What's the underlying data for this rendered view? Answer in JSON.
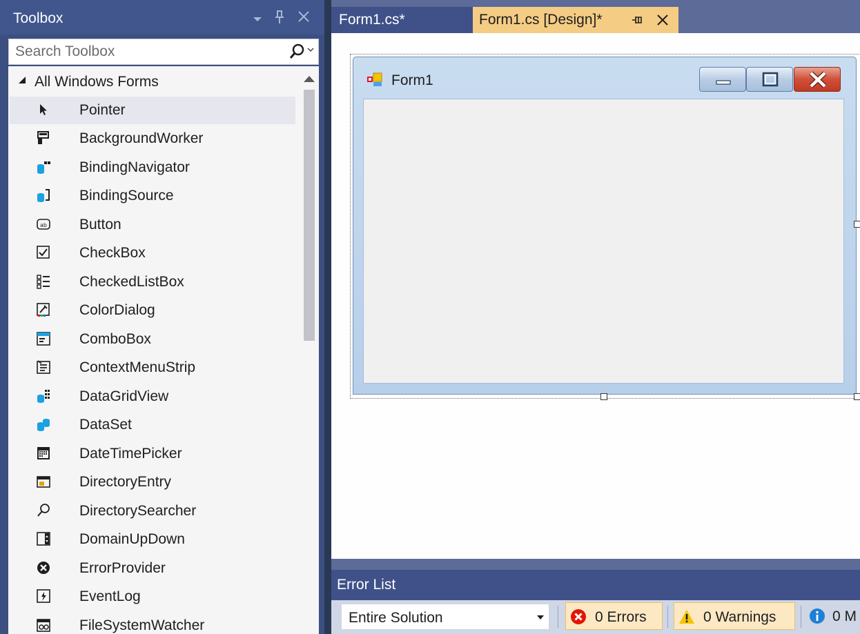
{
  "toolbox": {
    "title": "Toolbox",
    "header_icons": [
      "dropdown-arrow-icon",
      "pin-icon",
      "close-icon"
    ],
    "search_placeholder": "Search Toolbox",
    "group_label": "All Windows Forms",
    "items": [
      {
        "label": "Pointer",
        "icon": "pointer-icon"
      },
      {
        "label": "BackgroundWorker",
        "icon": "background-worker-icon"
      },
      {
        "label": "BindingNavigator",
        "icon": "binding-navigator-icon"
      },
      {
        "label": "BindingSource",
        "icon": "binding-source-icon"
      },
      {
        "label": "Button",
        "icon": "button-icon"
      },
      {
        "label": "CheckBox",
        "icon": "checkbox-icon"
      },
      {
        "label": "CheckedListBox",
        "icon": "checked-list-box-icon"
      },
      {
        "label": "ColorDialog",
        "icon": "color-dialog-icon"
      },
      {
        "label": "ComboBox",
        "icon": "combo-box-icon"
      },
      {
        "label": "ContextMenuStrip",
        "icon": "context-menu-strip-icon"
      },
      {
        "label": "DataGridView",
        "icon": "data-grid-view-icon"
      },
      {
        "label": "DataSet",
        "icon": "data-set-icon"
      },
      {
        "label": "DateTimePicker",
        "icon": "date-time-picker-icon"
      },
      {
        "label": "DirectoryEntry",
        "icon": "directory-entry-icon"
      },
      {
        "label": "DirectorySearcher",
        "icon": "directory-searcher-icon"
      },
      {
        "label": "DomainUpDown",
        "icon": "domain-up-down-icon"
      },
      {
        "label": "ErrorProvider",
        "icon": "error-provider-icon"
      },
      {
        "label": "EventLog",
        "icon": "event-log-icon"
      },
      {
        "label": "FileSystemWatcher",
        "icon": "file-system-watcher-icon"
      }
    ]
  },
  "tabs": {
    "code_tab": "Form1.cs*",
    "design_tab": "Form1.cs [Design]*"
  },
  "designer": {
    "form_title": "Form1"
  },
  "error_list": {
    "title": "Error List",
    "scope": "Entire Solution",
    "errors_label": "0 Errors",
    "warnings_label": "0 Warnings",
    "messages_label": "0 M"
  },
  "colors": {
    "accent_tab": "#f5cc84",
    "panel_header": "#40568d",
    "tab_strip": "#5d6b99"
  }
}
